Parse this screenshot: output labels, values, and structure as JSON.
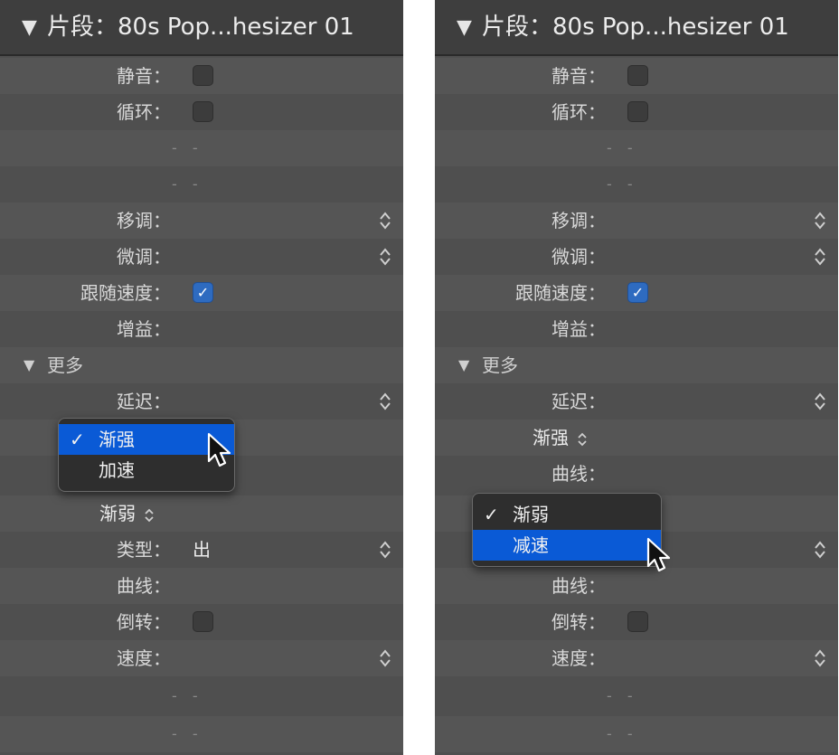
{
  "header": {
    "disclosure": "▼",
    "title": "片段：80s Pop...hesizer 01"
  },
  "labels": {
    "mute": "静音：",
    "loop": "循环：",
    "dash": "- -",
    "transpose": "移调：",
    "fine_tune": "微调：",
    "follow_tempo": "跟随速度：",
    "gain": "增益：",
    "more": "更多",
    "more_disclosure": "▼",
    "delay": "延迟：",
    "type": "类型：",
    "type_value": "出",
    "curve": "曲线：",
    "reverse": "倒转：",
    "speed": "速度："
  },
  "left_panel": {
    "fade_in_menu": {
      "items": [
        "渐强",
        "加速"
      ],
      "checked": "渐强",
      "highlighted": "渐强",
      "checkmark": "✓"
    },
    "fade_out_popup": "渐弱"
  },
  "right_panel": {
    "fade_in_popup": "渐强",
    "fade_out_menu": {
      "items": [
        "渐弱",
        "减速"
      ],
      "checked": "渐弱",
      "highlighted": "减速",
      "checkmark": "✓"
    }
  },
  "checkbox_states": {
    "mute": false,
    "loop": false,
    "follow_tempo": true,
    "reverse": false
  },
  "colors": {
    "panel_bg": "#4f4f4f",
    "header_bg": "#3e3e3e",
    "highlight": "#0a5ad6",
    "checkbox_on": "#2e6bc0"
  }
}
